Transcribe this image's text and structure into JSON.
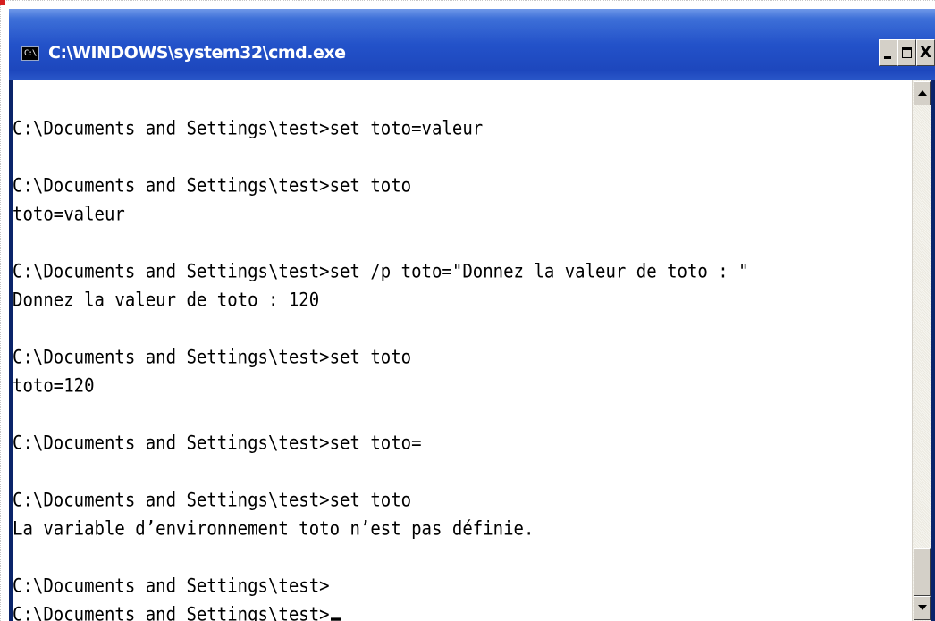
{
  "window": {
    "title": "C:\\WINDOWS\\system32\\cmd.exe",
    "icon": "cmd-console-icon",
    "icon_text": "C:\\",
    "buttons": {
      "minimize": "minimize-icon",
      "maximize": "maximize-icon",
      "close": "close-icon",
      "close_label": "X"
    }
  },
  "console": {
    "lines": [
      "C:\\Documents and Settings\\test>set toto=valeur",
      "",
      "C:\\Documents and Settings\\test>set toto",
      "toto=valeur",
      "",
      "C:\\Documents and Settings\\test>set /p toto=\"Donnez la valeur de toto : \"",
      "Donnez la valeur de toto : 120",
      "",
      "C:\\Documents and Settings\\test>set toto",
      "toto=120",
      "",
      "C:\\Documents and Settings\\test>set toto=",
      "",
      "C:\\Documents and Settings\\test>set toto",
      "La variable d’environnement toto n’est pas définie.",
      "",
      "C:\\Documents and Settings\\test>",
      "C:\\Documents and Settings\\test>"
    ]
  },
  "colors": {
    "titlebar": "#2352c9",
    "console_background": "#ffffff",
    "console_text": "#000000",
    "button_face": "#d4d0c8"
  }
}
